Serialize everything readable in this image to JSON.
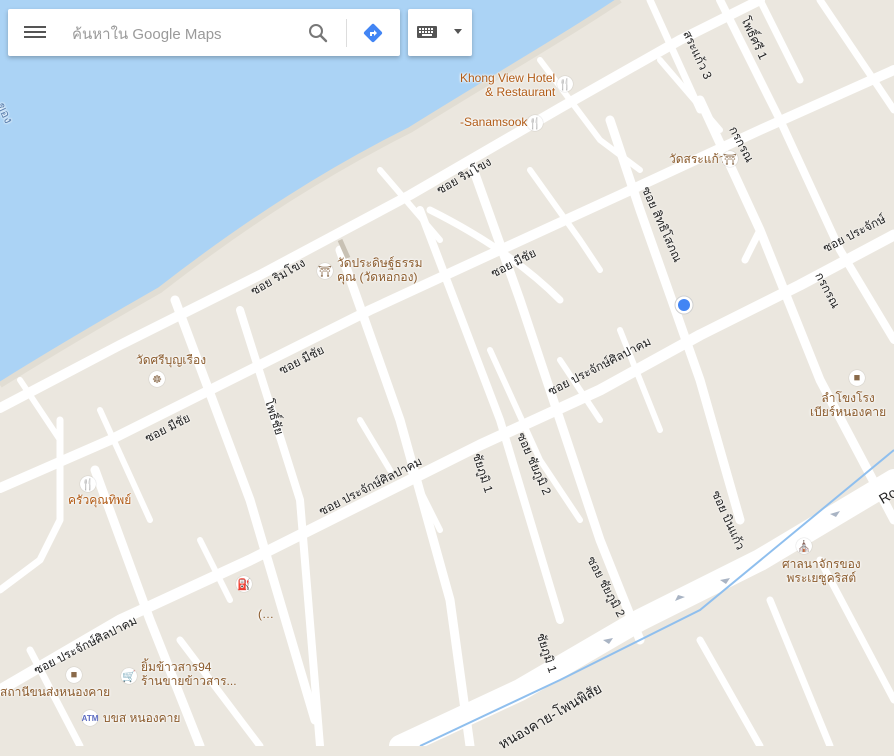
{
  "search": {
    "placeholder": "ค้นหาใน Google Maps",
    "value": ""
  },
  "map": {
    "water_label": "ของ",
    "roads": {
      "rim_khong_1": "ซอย ริมโขง",
      "rim_khong_2": "ซอย ริมโขง",
      "mi_chai_1": "ซอย มีชัย",
      "mi_chai_2": "ซอย มีชัย",
      "mi_chai_3": "ซอย มีชัย",
      "prajak_1": "ซอย ประจักษ์ศิลปาคม",
      "prajak_2": "ซอย ประจักษ์ศิลปาคม",
      "prajak_3": "ซอย ประจักษ์ศิลปาคม",
      "prajak_4": "ซอย ประจักษ์",
      "prajak_5": "ซอย ประจักษ์ศิลปาคม",
      "sa_kaeo_3": "สระแก้ว 3",
      "pho_si_1": "โพธิ์ศรี 1",
      "kon_kon_1": "กรกรณ",
      "kon_kon_2": "กรกรณ",
      "sitthi_sakon": "ซอย สิทธิโสภณ",
      "chai_ya_phum_1": "ชัยภูมิ 1",
      "chai_ya_phum_2": "ซอย ชัยภูมิ 2",
      "chai_ya_phum_3": "ซอย ชัยภูมิ 2",
      "chai_ya_phum_4": "ชัยภูมิ 1",
      "pho_chai": "โพธิ์ชัย",
      "bin_kaeo": "ซอย บินแก้ว",
      "highway": "หนองคาย-โพนพิสัย",
      "highway_ro": "Ro"
    },
    "pois": {
      "khong_view": "Khong View Hotel\n& Restaurant",
      "sanamsook": "-Sanamsook",
      "wat_sa_kaeo": "วัดสระแก้ว",
      "wat_prathit": "วัดประดิษฐ์ธรรม\nคุณ (วัดหอกอง)",
      "wat_si_bun": "วัดศรีบุญเรือง",
      "lam_khong": "ลำโขงโรง\nเบียร์หนองคาย",
      "khrua_khun": "ครัวคุณทิพย์",
      "san_chao": "ศาลนาจักรของ\nพระเยซูคริสต์",
      "gas_label": "(…",
      "yim": "ยิ้มข้าวสาร94\nร้านขายข้าวสาร...",
      "bus_station": "สถานีขนส่งหนองคาย",
      "atm": "บขส หนองคาย"
    }
  },
  "colors": {
    "land": "#ebe7df",
    "water": "#abd3f5",
    "road": "#ffffff",
    "accent_blue": "#4285f4",
    "poi_brown": "#8a5a2b",
    "food_orange": "#e8841b"
  },
  "icons": {
    "menu": "menu-icon",
    "search": "search-icon",
    "directions": "directions-icon",
    "keyboard": "keyboard-icon"
  }
}
